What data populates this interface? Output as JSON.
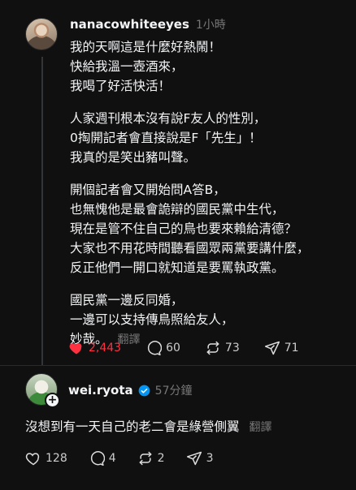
{
  "post": {
    "username": "nanacowhiteeyes",
    "time": "1小時",
    "paragraphs": [
      [
        "我的天啊這是什麼好熱鬧！",
        "快給我溫一壺酒來，",
        "我喝了好活快活！"
      ],
      [
        "人家週刊根本沒有說F友人的性別，",
        "0掏開記者會直接說是F「先生」！",
        "我真的是笑出豬叫聲。"
      ],
      [
        "開個記者會又開始問A答B，",
        "也無愧他是最會詭辯的國民黨中生代，",
        "現在是管不住自己的鳥也要來賴給清德？",
        "大家也不用花時間聽看國眾兩黨要講什麼，",
        "反正他們一開口就知道是要罵執政黨。"
      ],
      [
        "國民黨一邊反同婚，",
        "一邊可以支持傳鳥照給友人，",
        "妙哉。"
      ]
    ],
    "translate": "翻譯",
    "likes": "2,443",
    "replies": "60",
    "reposts": "73",
    "shares": "71",
    "like_color": "#ff3040"
  },
  "reply": {
    "username": "wei.ryota",
    "verified": true,
    "time": "57分鐘",
    "text": "沒想到有一天自己的老二會是綠營側翼",
    "translate": "翻譯",
    "likes": "128",
    "replies": "4",
    "reposts": "2",
    "shares": "3",
    "follow_icon": "+"
  },
  "colors": {
    "background": "#101010",
    "text": "#f3f5f7",
    "muted": "#777777",
    "verified": "#0095f6"
  },
  "icons": [
    "heart-icon",
    "comment-icon",
    "repost-icon",
    "share-icon",
    "verified-badge-icon",
    "follow-plus-icon"
  ]
}
